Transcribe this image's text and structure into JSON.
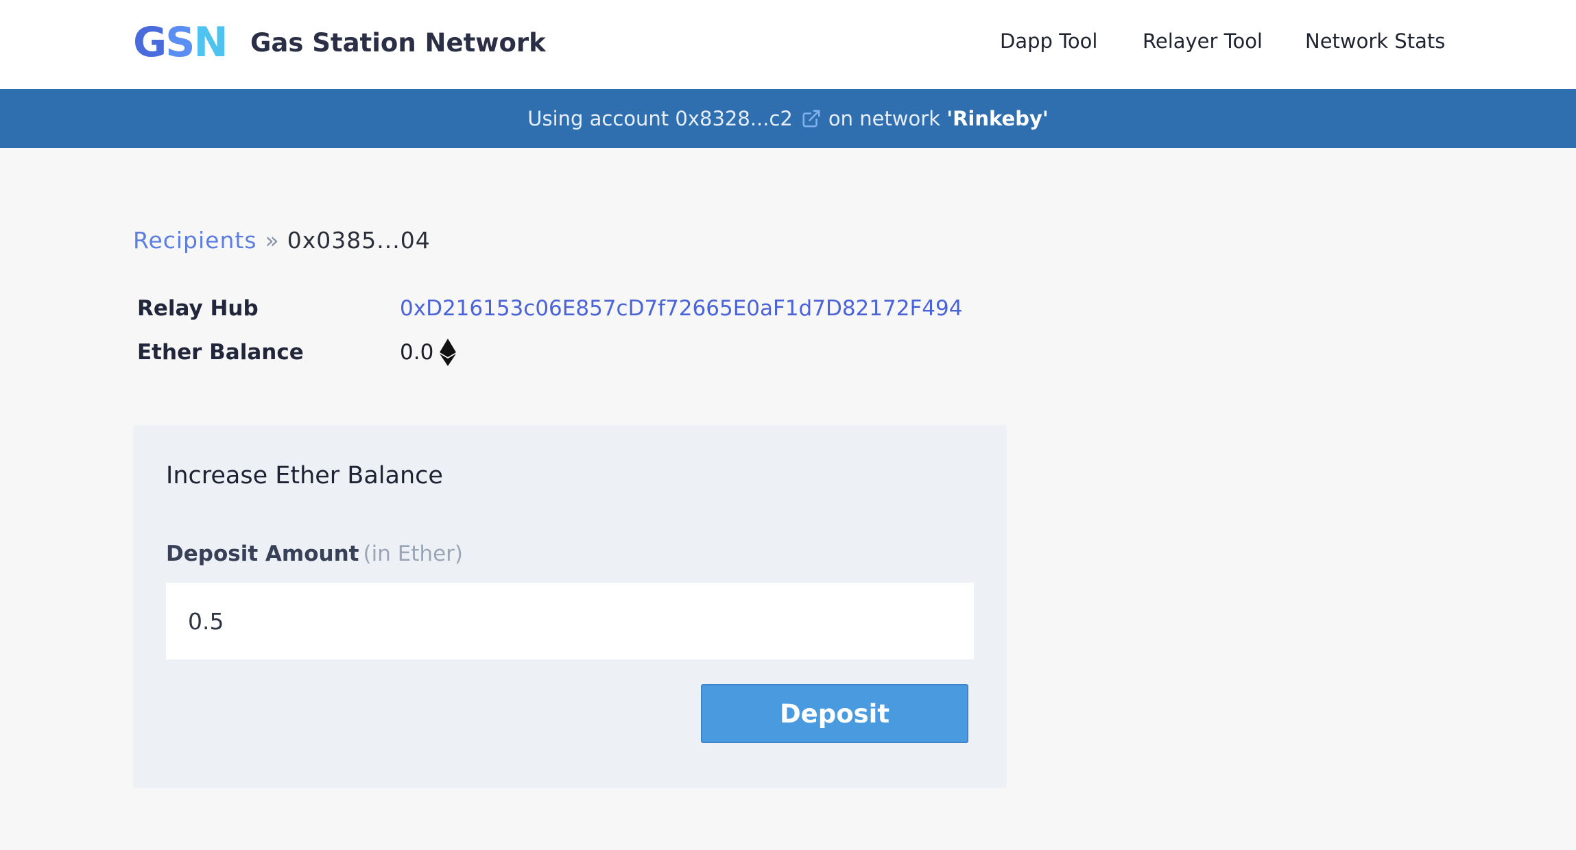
{
  "header": {
    "logo_letters": {
      "g": "G",
      "s": "S",
      "n": "N"
    },
    "title": "Gas Station Network",
    "nav": [
      {
        "label": "Dapp Tool"
      },
      {
        "label": "Relayer Tool"
      },
      {
        "label": "Network Stats"
      }
    ]
  },
  "banner": {
    "prefix": "Using account 0x8328...c2",
    "middle": "on network",
    "network": "'Rinkeby'",
    "icon": "external-link-icon"
  },
  "breadcrumb": {
    "parent": "Recipients",
    "separator": "»",
    "current": "0x0385...04"
  },
  "info": {
    "relay_hub_label": "Relay Hub",
    "relay_hub_value": "0xD216153c06E857cD7f72665E0aF1d7D82172F494",
    "ether_balance_label": "Ether Balance",
    "ether_balance_value": "0.0",
    "ether_icon": "ethereum-icon"
  },
  "card": {
    "title": "Increase Ether Balance",
    "field_label": "Deposit Amount",
    "field_hint": "(in Ether)",
    "amount_value": "0.5",
    "button_label": "Deposit"
  },
  "colors": {
    "banner": "#2f6fb0",
    "link": "#4a63d6",
    "button": "#4a9ae0",
    "card": "#edf1f6"
  }
}
